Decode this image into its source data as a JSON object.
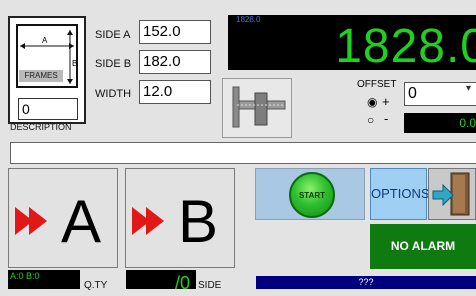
{
  "frames": {
    "caption": "FRAMES",
    "value": "0",
    "label_a": "A",
    "label_b": "B"
  },
  "side_a": {
    "label": "SIDE A",
    "value": "152.0"
  },
  "side_b": {
    "label": "SIDE B",
    "value": "182.0"
  },
  "width": {
    "label": "WIDTH",
    "value": "12.0"
  },
  "big_display": {
    "small_value": "1828.0",
    "red_value": "0",
    "main_value": "1828.0"
  },
  "offset": {
    "label": "OFFSET",
    "plus_label": "+",
    "minus_label": "-",
    "value": "0",
    "display": "0.0",
    "selected": "plus"
  },
  "description": {
    "label": "DESCRIPTION",
    "value": ""
  },
  "buttons": {
    "a_letter": "A",
    "b_letter": "B",
    "start": "START",
    "options": "OPTIONS"
  },
  "alarm": {
    "text": "NO ALARM"
  },
  "status": {
    "ab": "A:0 B:0",
    "qty_label": "Q.TY",
    "qty_value": "/0",
    "side_label": "SIDE",
    "bottom_text": "???"
  },
  "colors": {
    "display_green": "#1fd11f",
    "alarm_green": "#0f7a0f",
    "arrow_red": "#e01818",
    "bottom_bar": "#00007f"
  },
  "icons": {
    "caliper": "caliper-icon",
    "exit": "exit-door-icon",
    "play_arrows": "double-arrow-icon"
  }
}
